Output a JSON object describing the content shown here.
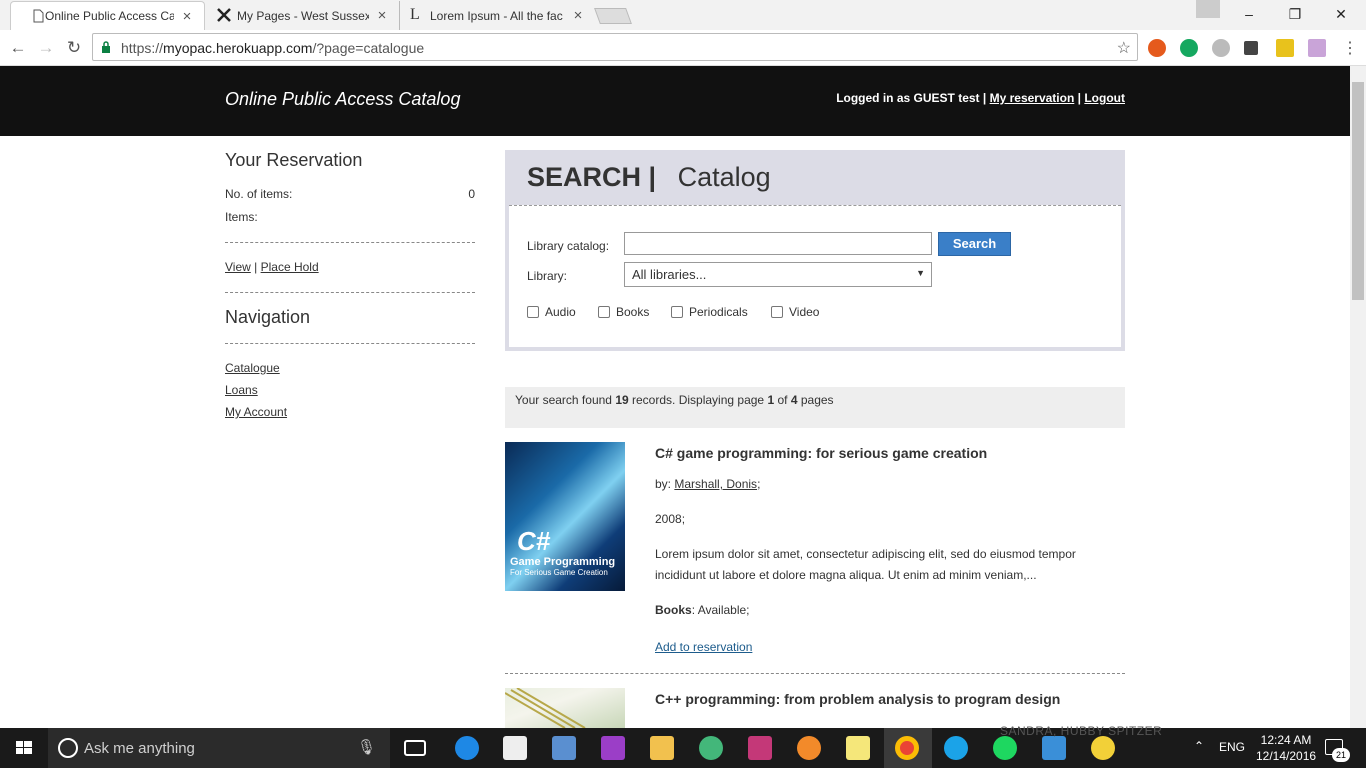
{
  "browser": {
    "tabs": [
      {
        "title": "Online Public Access Cat",
        "active": true
      },
      {
        "title": "My Pages - West Sussex",
        "active": false
      },
      {
        "title": "Lorem Ipsum - All the fac",
        "active": false
      }
    ],
    "url_scheme": "https://",
    "url_host": "myopac.herokuapp.com",
    "url_path": "/?page=catalogue"
  },
  "site": {
    "title": "Online Public Access Catalog",
    "login_prefix": "Logged in as GUEST test",
    "my_reservation": "My reservation",
    "logout": "Logout",
    "sep": "|"
  },
  "sidebar": {
    "reservation_heading": "Your Reservation",
    "no_items_label": "No. of items:",
    "no_items_value": "0",
    "items_label": "Items:",
    "view_link": "View",
    "place_hold_link": "Place Hold",
    "navigation_heading": "Navigation",
    "nav_links": [
      "Catalogue",
      "Loans",
      "My Account"
    ]
  },
  "search": {
    "heading_bold": "SEARCH |",
    "heading_light": "Catalog",
    "catalog_label": "Library catalog:",
    "catalog_value": "",
    "search_button": "Search",
    "library_label": "Library:",
    "library_selected": "All libraries...",
    "checkboxes": [
      "Audio",
      "Books",
      "Periodicals",
      "Video"
    ]
  },
  "results": {
    "prefix": "Your search found",
    "count": "19",
    "middle": "records. Displaying page",
    "page": "1",
    "of": "of",
    "pages": "4",
    "suffix": "pages"
  },
  "books": [
    {
      "title": "C# game programming: for serious game creation",
      "by_label": "by:",
      "author": "Marshall, Donis",
      "author_suffix": ";",
      "year": "2008;",
      "description": "Lorem ipsum dolor sit amet, consectetur adipiscing elit, sed do eiusmod tempor incididunt ut labore et dolore magna aliqua. Ut enim ad minim veniam,...",
      "format": "Books",
      "availability": ": Available;",
      "add_link": "Add to reservation",
      "cover_big": "C#",
      "cover_sub1": "Game Programming",
      "cover_sub2": "For Serious Game Creation"
    },
    {
      "title": "C++ programming: from problem analysis to program design"
    }
  ],
  "taskbar": {
    "search_placeholder": "Ask me anything",
    "lang": "ENG",
    "time": "12:24 AM",
    "date": "12/14/2016",
    "notifications": "21",
    "ghost_text": "SANDRA, HUBBY SPITZER"
  }
}
